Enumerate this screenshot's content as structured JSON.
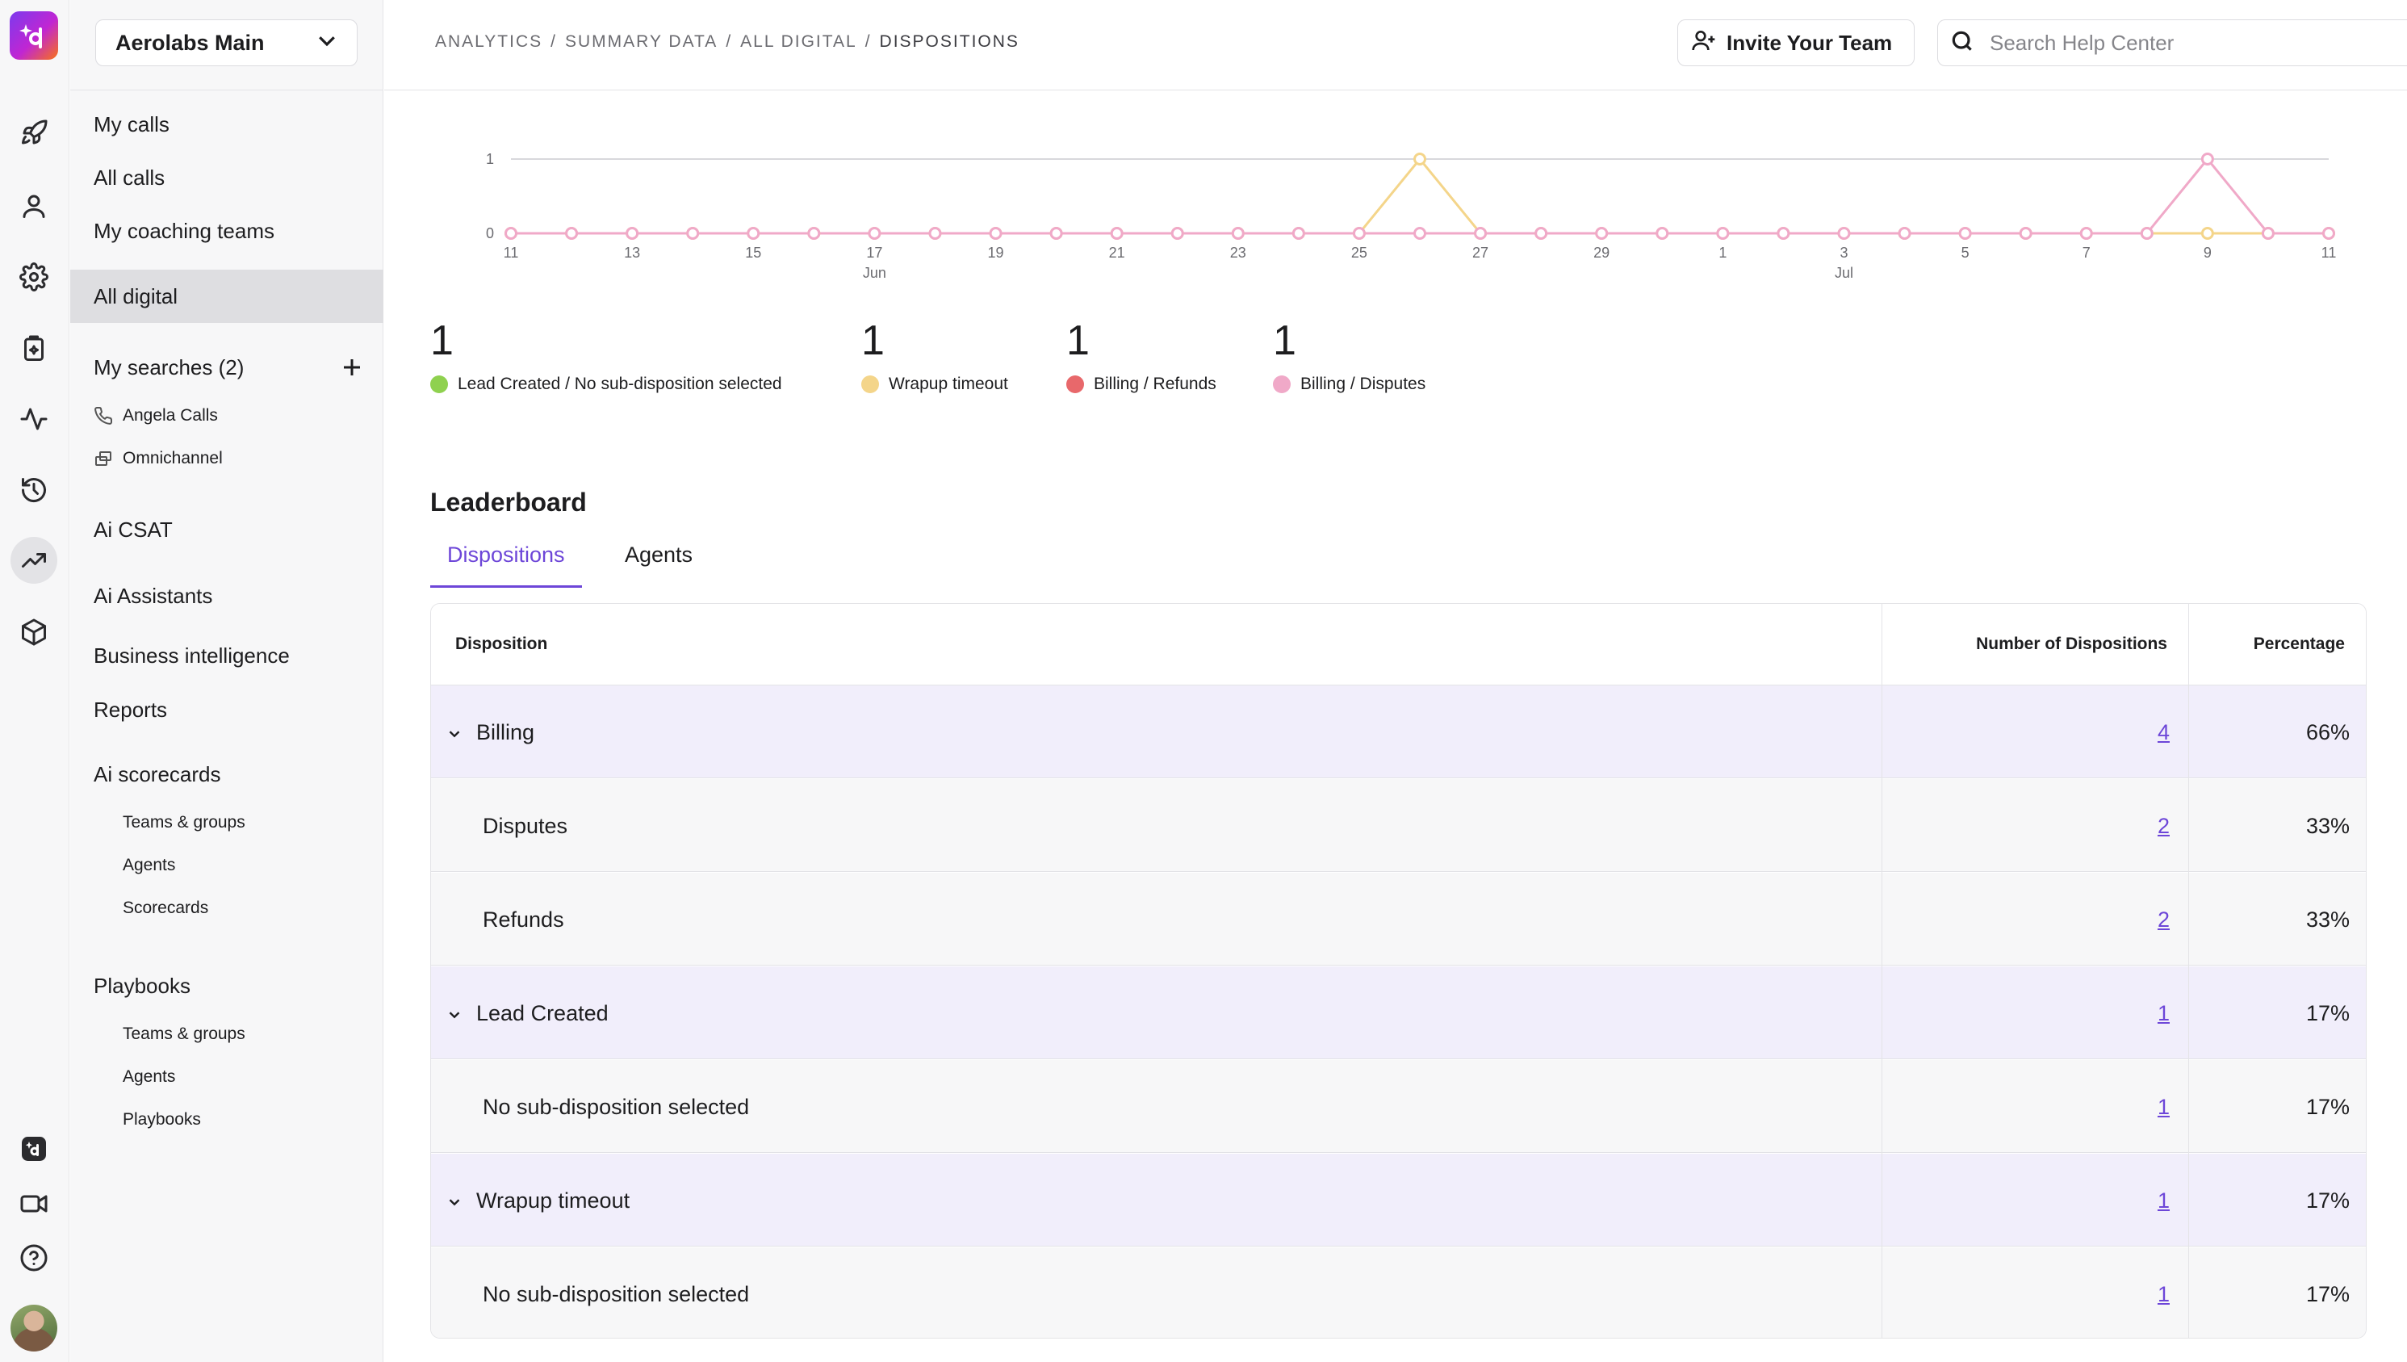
{
  "workspace": {
    "name": "Aerolabs Main"
  },
  "sidebar": {
    "my_calls": "My calls",
    "all_calls": "All calls",
    "coaching": "My coaching teams",
    "all_digital": "All digital",
    "my_searches": "My searches (2)",
    "searches": [
      "Angela Calls",
      "Omnichannel"
    ],
    "ai_csat": "Ai CSAT",
    "ai_assistants": "Ai Assistants",
    "bi": "Business intelligence",
    "reports": "Reports",
    "ai_scorecards": "Ai scorecards",
    "scorecard_items": [
      "Teams & groups",
      "Agents",
      "Scorecards"
    ],
    "playbooks": "Playbooks",
    "playbook_items": [
      "Teams & groups",
      "Agents",
      "Playbooks"
    ]
  },
  "rail": {
    "icons": [
      "rocket-icon",
      "person-icon",
      "gear-icon",
      "clipboard-sparkle-icon",
      "activity-icon",
      "history-icon",
      "trending-icon",
      "cube-icon",
      "brand-icon",
      "video-icon",
      "help-icon"
    ]
  },
  "breadcrumb": {
    "items": [
      "Analytics",
      "Summary Data",
      "All Digital",
      "Dispositions"
    ]
  },
  "header": {
    "invite_label": "Invite Your Team",
    "search_placeholder": "Search Help Center"
  },
  "chart_data": {
    "type": "line",
    "x": [
      "Jun 11",
      "Jun 12",
      "Jun 13",
      "Jun 14",
      "Jun 15",
      "Jun 16",
      "Jun 17",
      "Jun 18",
      "Jun 19",
      "Jun 20",
      "Jun 21",
      "Jun 22",
      "Jun 23",
      "Jun 24",
      "Jun 25",
      "Jun 26",
      "Jun 27",
      "Jun 28",
      "Jun 29",
      "Jun 30",
      "Jul 1",
      "Jul 2",
      "Jul 3",
      "Jul 4",
      "Jul 5",
      "Jul 6",
      "Jul 7",
      "Jul 8",
      "Jul 9",
      "Jul 10",
      "Jul 11"
    ],
    "tick_labels": [
      "11",
      "13",
      "15",
      "17",
      "19",
      "21",
      "23",
      "25",
      "27",
      "29",
      "1",
      "3",
      "5",
      "7",
      "9",
      "11"
    ],
    "month_labels": [
      {
        "label": "Jun",
        "at": "Jun 17"
      },
      {
        "label": "Jul",
        "at": "Jul 3"
      }
    ],
    "y_ticks": [
      "0",
      "1"
    ],
    "ylim": [
      0,
      1
    ],
    "series": [
      {
        "name": "Wrapup timeout",
        "color": "#f4d58a",
        "values": [
          0,
          0,
          0,
          0,
          0,
          0,
          0,
          0,
          0,
          0,
          0,
          0,
          0,
          0,
          0,
          1,
          0,
          0,
          0,
          0,
          0,
          0,
          0,
          0,
          0,
          0,
          0,
          0,
          0,
          0,
          0
        ]
      },
      {
        "name": "Billing / Disputes",
        "color": "#f0a9c8",
        "values": [
          0,
          0,
          0,
          0,
          0,
          0,
          0,
          0,
          0,
          0,
          0,
          0,
          0,
          0,
          0,
          0,
          0,
          0,
          0,
          0,
          0,
          0,
          0,
          0,
          0,
          0,
          0,
          0,
          1,
          0,
          0
        ]
      }
    ]
  },
  "totals": [
    {
      "value": "1",
      "label": "Lead Created / No sub-disposition selected",
      "color": "#8fd14f"
    },
    {
      "value": "1",
      "label": "Wrapup timeout",
      "color": "#f4d58a"
    },
    {
      "value": "1",
      "label": "Billing / Refunds",
      "color": "#e8686b"
    },
    {
      "value": "1",
      "label": "Billing / Disputes",
      "color": "#f0a9c8"
    }
  ],
  "leaderboard": {
    "title": "Leaderboard",
    "tabs": [
      "Dispositions",
      "Agents"
    ],
    "columns": [
      "Disposition",
      "Number of Dispositions",
      "Percentage"
    ],
    "rows": [
      {
        "type": "parent",
        "name": "Billing",
        "count": "4",
        "pct": "66%"
      },
      {
        "type": "child",
        "name": "Disputes",
        "count": "2",
        "pct": "33%"
      },
      {
        "type": "child",
        "name": "Refunds",
        "count": "2",
        "pct": "33%"
      },
      {
        "type": "parent",
        "name": "Lead Created",
        "count": "1",
        "pct": "17%"
      },
      {
        "type": "child",
        "name": "No sub-disposition selected",
        "count": "1",
        "pct": "17%"
      },
      {
        "type": "parent",
        "name": "Wrapup timeout",
        "count": "1",
        "pct": "17%"
      },
      {
        "type": "child",
        "name": "No sub-disposition selected",
        "count": "1",
        "pct": "17%"
      }
    ]
  }
}
